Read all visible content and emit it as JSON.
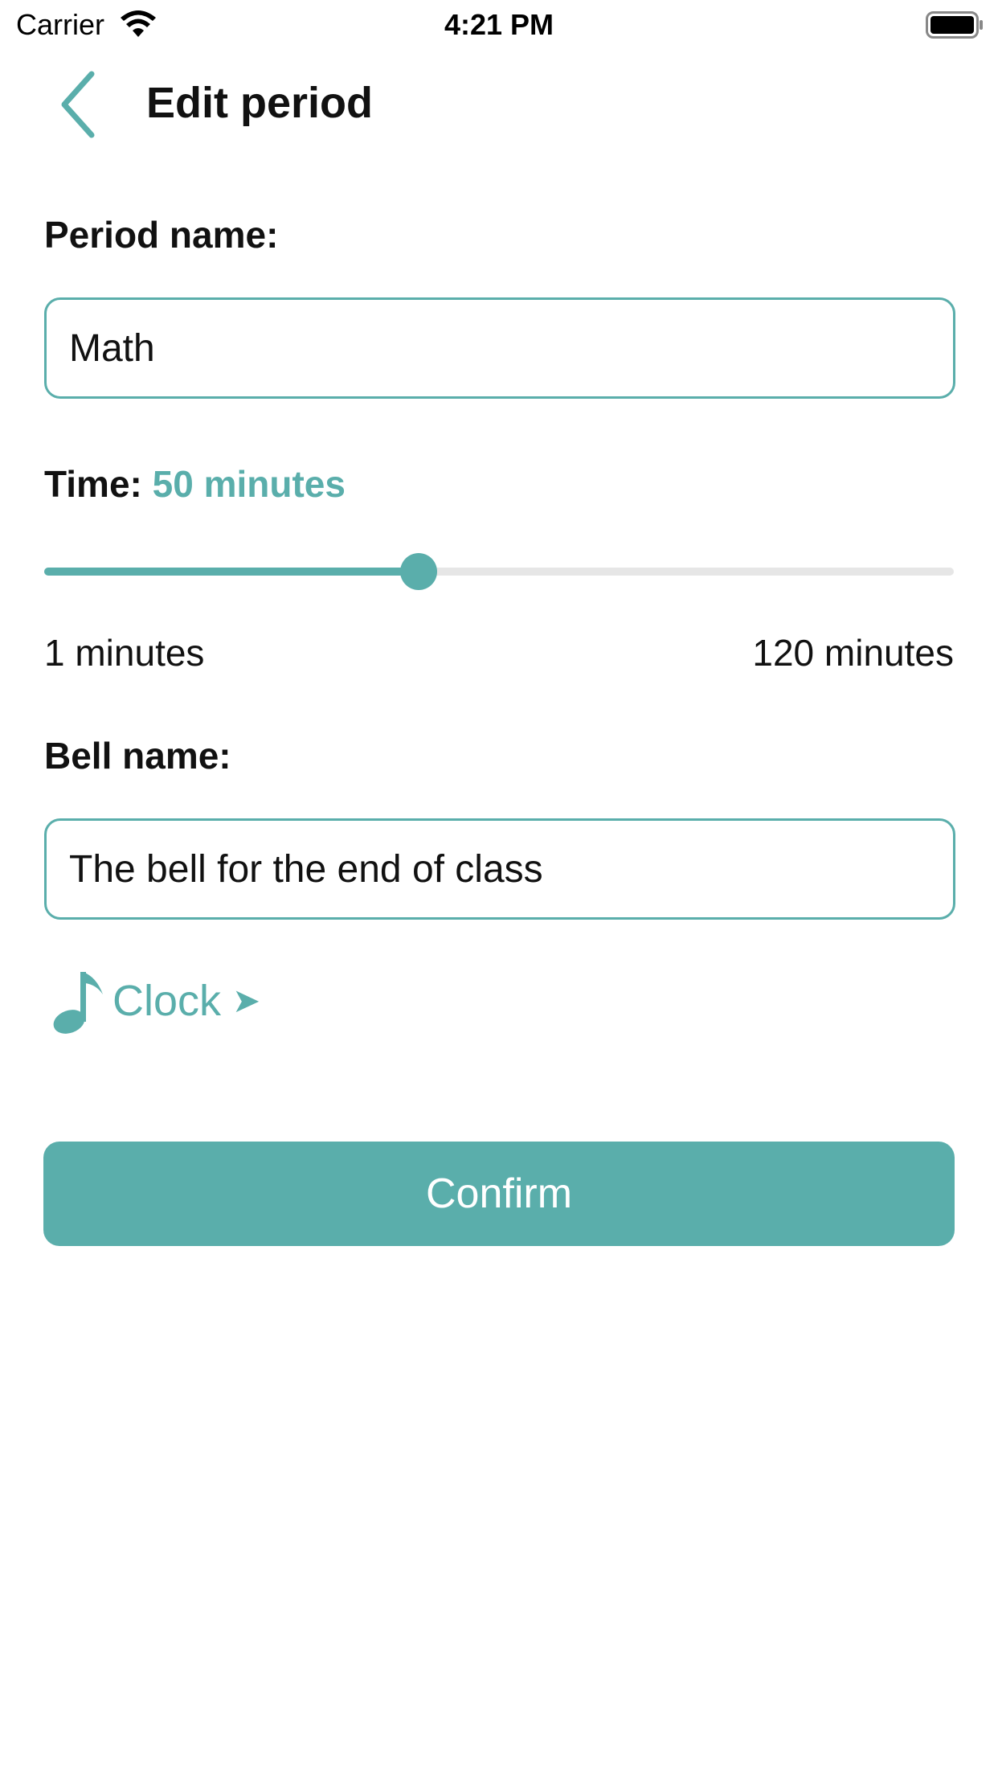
{
  "status_bar": {
    "carrier": "Carrier",
    "time": "4:21 PM",
    "wifi_icon": "wifi-icon",
    "battery_icon": "battery-icon"
  },
  "nav": {
    "back_icon": "chevron-left-icon",
    "title": "Edit period"
  },
  "period": {
    "label": "Period name:",
    "value": "Math"
  },
  "time": {
    "label": "Time:",
    "value_text": "50 minutes",
    "value": 50,
    "min": 1,
    "max": 120,
    "min_label": "1 minutes",
    "max_label": "120 minutes"
  },
  "bell": {
    "label": "Bell name:",
    "value": "The bell for the end of class"
  },
  "sound": {
    "icon": "music-note-icon",
    "label": "Clock",
    "arrow": "➤"
  },
  "confirm_label": "Confirm",
  "colors": {
    "accent": "#5aaeab",
    "track": "#e6e6e6",
    "text": "#111111",
    "background": "#ffffff"
  }
}
